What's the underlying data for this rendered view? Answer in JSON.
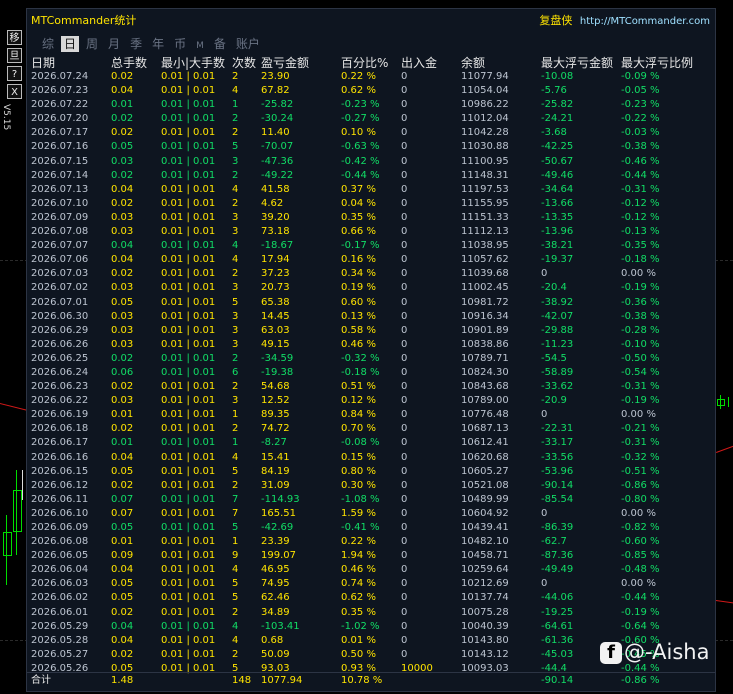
{
  "title": "MTCommander统计",
  "brand": "复盘侠",
  "url": "http://MTCommander.com",
  "version": "V5.15",
  "tool_buttons": [
    "移",
    "旦",
    "?",
    "X"
  ],
  "tabs": [
    "综",
    "日",
    "周",
    "月",
    "季",
    "年",
    "币",
    "M",
    "备",
    "账户"
  ],
  "active_tab": "日",
  "columns": [
    "日期",
    "总手数",
    "最小|大手数",
    "次数",
    "盈亏金额",
    "百分比%",
    "出入金",
    "余额",
    "最大浮亏金额",
    "最大浮亏比例"
  ],
  "colors": {
    "green": "#11dd66",
    "yellow": "#ffe400",
    "title": "#ffe400",
    "url": "#9fe0ff"
  },
  "rows": [
    [
      "2026.07.24",
      "0.02",
      "0.01 | 0.01",
      "2",
      "23.90",
      "0.22 %",
      "0",
      "11077.94",
      "-10.08",
      "-0.09 %"
    ],
    [
      "2026.07.23",
      "0.04",
      "0.01 | 0.01",
      "4",
      "67.82",
      "0.62 %",
      "0",
      "11054.04",
      "-5.76",
      "-0.05 %"
    ],
    [
      "2026.07.22",
      "0.01",
      "0.01 | 0.01",
      "1",
      "-25.82",
      "-0.23 %",
      "0",
      "10986.22",
      "-25.82",
      "-0.23 %"
    ],
    [
      "2026.07.20",
      "0.02",
      "0.01 | 0.01",
      "2",
      "-30.24",
      "-0.27 %",
      "0",
      "11012.04",
      "-24.21",
      "-0.22 %"
    ],
    [
      "2026.07.17",
      "0.02",
      "0.01 | 0.01",
      "2",
      "11.40",
      "0.10 %",
      "0",
      "11042.28",
      "-3.68",
      "-0.03 %"
    ],
    [
      "2026.07.16",
      "0.05",
      "0.01 | 0.01",
      "5",
      "-70.07",
      "-0.63 %",
      "0",
      "11030.88",
      "-42.25",
      "-0.38 %"
    ],
    [
      "2026.07.15",
      "0.03",
      "0.01 | 0.01",
      "3",
      "-47.36",
      "-0.42 %",
      "0",
      "11100.95",
      "-50.67",
      "-0.46 %"
    ],
    [
      "2026.07.14",
      "0.02",
      "0.01 | 0.01",
      "2",
      "-49.22",
      "-0.44 %",
      "0",
      "11148.31",
      "-49.46",
      "-0.44 %"
    ],
    [
      "2026.07.13",
      "0.04",
      "0.01 | 0.01",
      "4",
      "41.58",
      "0.37 %",
      "0",
      "11197.53",
      "-34.64",
      "-0.31 %"
    ],
    [
      "2026.07.10",
      "0.02",
      "0.01 | 0.01",
      "2",
      "4.62",
      "0.04 %",
      "0",
      "11155.95",
      "-13.66",
      "-0.12 %"
    ],
    [
      "2026.07.09",
      "0.03",
      "0.01 | 0.01",
      "3",
      "39.20",
      "0.35 %",
      "0",
      "11151.33",
      "-13.35",
      "-0.12 %"
    ],
    [
      "2026.07.08",
      "0.03",
      "0.01 | 0.01",
      "3",
      "73.18",
      "0.66 %",
      "0",
      "11112.13",
      "-13.96",
      "-0.13 %"
    ],
    [
      "2026.07.07",
      "0.04",
      "0.01 | 0.01",
      "4",
      "-18.67",
      "-0.17 %",
      "0",
      "11038.95",
      "-38.21",
      "-0.35 %"
    ],
    [
      "2026.07.06",
      "0.04",
      "0.01 | 0.01",
      "4",
      "17.94",
      "0.16 %",
      "0",
      "11057.62",
      "-19.37",
      "-0.18 %"
    ],
    [
      "2026.07.03",
      "0.02",
      "0.01 | 0.01",
      "2",
      "37.23",
      "0.34 %",
      "0",
      "11039.68",
      "0",
      "0.00 %"
    ],
    [
      "2026.07.02",
      "0.03",
      "0.01 | 0.01",
      "3",
      "20.73",
      "0.19 %",
      "0",
      "11002.45",
      "-20.4",
      "-0.19 %"
    ],
    [
      "2026.07.01",
      "0.05",
      "0.01 | 0.01",
      "5",
      "65.38",
      "0.60 %",
      "0",
      "10981.72",
      "-38.92",
      "-0.36 %"
    ],
    [
      "2026.06.30",
      "0.03",
      "0.01 | 0.01",
      "3",
      "14.45",
      "0.13 %",
      "0",
      "10916.34",
      "-42.07",
      "-0.38 %"
    ],
    [
      "2026.06.29",
      "0.03",
      "0.01 | 0.01",
      "3",
      "63.03",
      "0.58 %",
      "0",
      "10901.89",
      "-29.88",
      "-0.28 %"
    ],
    [
      "2026.06.26",
      "0.03",
      "0.01 | 0.01",
      "3",
      "49.15",
      "0.46 %",
      "0",
      "10838.86",
      "-11.23",
      "-0.10 %"
    ],
    [
      "2026.06.25",
      "0.02",
      "0.01 | 0.01",
      "2",
      "-34.59",
      "-0.32 %",
      "0",
      "10789.71",
      "-54.5",
      "-0.50 %"
    ],
    [
      "2026.06.24",
      "0.06",
      "0.01 | 0.01",
      "6",
      "-19.38",
      "-0.18 %",
      "0",
      "10824.30",
      "-58.89",
      "-0.54 %"
    ],
    [
      "2026.06.23",
      "0.02",
      "0.01 | 0.01",
      "2",
      "54.68",
      "0.51 %",
      "0",
      "10843.68",
      "-33.62",
      "-0.31 %"
    ],
    [
      "2026.06.22",
      "0.03",
      "0.01 | 0.01",
      "3",
      "12.52",
      "0.12 %",
      "0",
      "10789.00",
      "-20.9",
      "-0.19 %"
    ],
    [
      "2026.06.19",
      "0.01",
      "0.01 | 0.01",
      "1",
      "89.35",
      "0.84 %",
      "0",
      "10776.48",
      "0",
      "0.00 %"
    ],
    [
      "2026.06.18",
      "0.02",
      "0.01 | 0.01",
      "2",
      "74.72",
      "0.70 %",
      "0",
      "10687.13",
      "-22.31",
      "-0.21 %"
    ],
    [
      "2026.06.17",
      "0.01",
      "0.01 | 0.01",
      "1",
      "-8.27",
      "-0.08 %",
      "0",
      "10612.41",
      "-33.17",
      "-0.31 %"
    ],
    [
      "2026.06.16",
      "0.04",
      "0.01 | 0.01",
      "4",
      "15.41",
      "0.15 %",
      "0",
      "10620.68",
      "-33.56",
      "-0.32 %"
    ],
    [
      "2026.06.15",
      "0.05",
      "0.01 | 0.01",
      "5",
      "84.19",
      "0.80 %",
      "0",
      "10605.27",
      "-53.96",
      "-0.51 %"
    ],
    [
      "2026.06.12",
      "0.02",
      "0.01 | 0.01",
      "2",
      "31.09",
      "0.30 %",
      "0",
      "10521.08",
      "-90.14",
      "-0.86 %"
    ],
    [
      "2026.06.11",
      "0.07",
      "0.01 | 0.01",
      "7",
      "-114.93",
      "-1.08 %",
      "0",
      "10489.99",
      "-85.54",
      "-0.80 %"
    ],
    [
      "2026.06.10",
      "0.07",
      "0.01 | 0.01",
      "7",
      "165.51",
      "1.59 %",
      "0",
      "10604.92",
      "0",
      "0.00 %"
    ],
    [
      "2026.06.09",
      "0.05",
      "0.01 | 0.01",
      "5",
      "-42.69",
      "-0.41 %",
      "0",
      "10439.41",
      "-86.39",
      "-0.82 %"
    ],
    [
      "2026.06.08",
      "0.01",
      "0.01 | 0.01",
      "1",
      "23.39",
      "0.22 %",
      "0",
      "10482.10",
      "-62.7",
      "-0.60 %"
    ],
    [
      "2026.06.05",
      "0.09",
      "0.01 | 0.01",
      "9",
      "199.07",
      "1.94 %",
      "0",
      "10458.71",
      "-87.36",
      "-0.85 %"
    ],
    [
      "2026.06.04",
      "0.04",
      "0.01 | 0.01",
      "4",
      "46.95",
      "0.46 %",
      "0",
      "10259.64",
      "-49.49",
      "-0.48 %"
    ],
    [
      "2026.06.03",
      "0.05",
      "0.01 | 0.01",
      "5",
      "74.95",
      "0.74 %",
      "0",
      "10212.69",
      "0",
      "0.00 %"
    ],
    [
      "2026.06.02",
      "0.05",
      "0.01 | 0.01",
      "5",
      "62.46",
      "0.62 %",
      "0",
      "10137.74",
      "-44.06",
      "-0.44 %"
    ],
    [
      "2026.06.01",
      "0.02",
      "0.01 | 0.01",
      "2",
      "34.89",
      "0.35 %",
      "0",
      "10075.28",
      "-19.25",
      "-0.19 %"
    ],
    [
      "2026.05.29",
      "0.04",
      "0.01 | 0.01",
      "4",
      "-103.41",
      "-1.02 %",
      "0",
      "10040.39",
      "-64.61",
      "-0.64 %"
    ],
    [
      "2026.05.28",
      "0.04",
      "0.01 | 0.01",
      "4",
      "0.68",
      "0.01 %",
      "0",
      "10143.80",
      "-61.36",
      "-0.60 %"
    ],
    [
      "2026.05.27",
      "0.02",
      "0.01 | 0.01",
      "2",
      "50.09",
      "0.50 %",
      "0",
      "10143.12",
      "-45.03",
      "-0.45 %"
    ],
    [
      "2026.05.26",
      "0.05",
      "0.01 | 0.01",
      "5",
      "93.03",
      "0.93 %",
      "10000",
      "10093.03",
      "-44.4",
      "-0.44 %"
    ]
  ],
  "total": {
    "label": "合计",
    "lots": "1.48",
    "count": "148",
    "profit": "1077.94",
    "pct": "10.78 %",
    "max_dd": "-90.14",
    "max_dd_pct": "-0.86 %"
  },
  "watermark": {
    "logo": "f",
    "text": "@-Aisha"
  }
}
